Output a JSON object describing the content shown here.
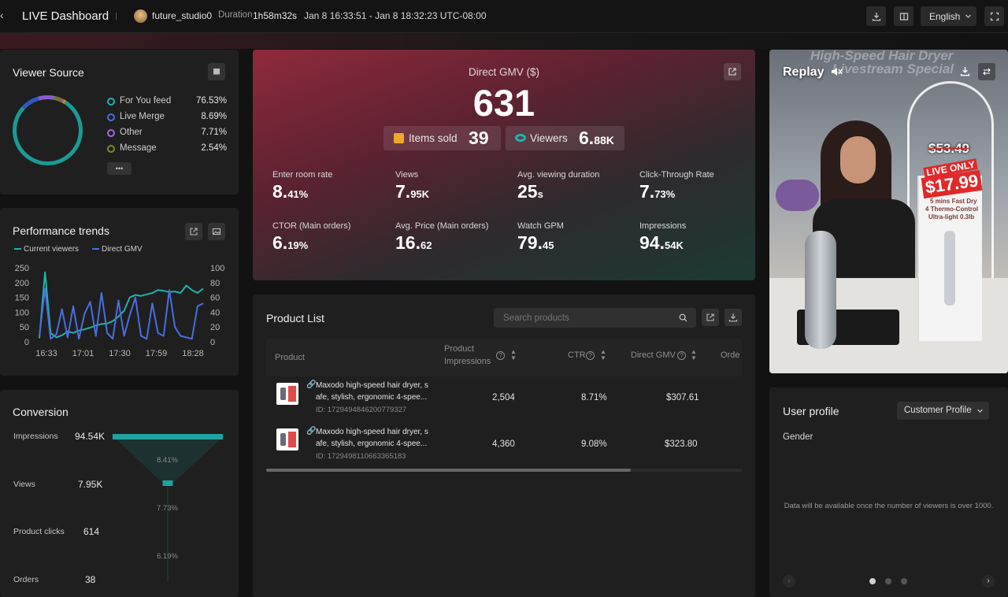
{
  "topbar": {
    "title": "LIVE Dashboard",
    "creator": "future_studio0",
    "duration_label": "Duration",
    "duration_value": "1h58m32s",
    "time_range": "Jan 8 16:33:51 - Jan 8 18:32:23 UTC-08:00",
    "language": "English"
  },
  "viewer_source": {
    "title": "Viewer Source",
    "items": [
      {
        "label": "For You feed",
        "value": "76.53%",
        "color": "#20b2aa"
      },
      {
        "label": "Live Merge",
        "value": "8.69%",
        "color": "#4a6ee0"
      },
      {
        "label": "Other",
        "value": "7.71%",
        "color": "#a06be0"
      },
      {
        "label": "Message",
        "value": "2.54%",
        "color": "#7a8a2a"
      }
    ],
    "more": "•••"
  },
  "performance": {
    "title": "Performance trends",
    "legend": [
      {
        "label": "Current viewers",
        "color": "#20b2aa"
      },
      {
        "label": "Direct GMV",
        "color": "#4a6ee0"
      }
    ]
  },
  "chart_data": {
    "type": "line",
    "x": [
      "16:33",
      "17:01",
      "17:30",
      "17:59",
      "18:28"
    ],
    "left_ticks": [
      "250",
      "200",
      "150",
      "100",
      "50",
      "0"
    ],
    "right_ticks": [
      "100",
      "80",
      "60",
      "40",
      "20",
      "0"
    ],
    "ylim_left": [
      0,
      250
    ],
    "ylim_right": [
      0,
      100
    ],
    "series": [
      {
        "name": "Current viewers",
        "color": "#20b2aa",
        "axis": "left",
        "values": [
          12,
          235,
          30,
          15,
          22,
          35,
          30,
          38,
          42,
          48,
          55,
          60,
          62,
          70,
          85,
          105,
          150,
          158,
          155,
          160,
          165,
          175,
          172,
          168,
          170,
          165,
          190,
          175,
          165,
          180
        ]
      },
      {
        "name": "Direct GMV",
        "color": "#4a6ee0",
        "axis": "left",
        "values": [
          20,
          180,
          10,
          25,
          110,
          15,
          120,
          10,
          95,
          135,
          20,
          165,
          30,
          10,
          140,
          20,
          90,
          150,
          20,
          10,
          130,
          30,
          20,
          175,
          50,
          20,
          15,
          10,
          120,
          130
        ]
      }
    ]
  },
  "conversion": {
    "title": "Conversion",
    "stages": [
      {
        "label": "Impressions",
        "value": "94.54K"
      },
      {
        "label": "Views",
        "value": "7.95K"
      },
      {
        "label": "Product clicks",
        "value": "614"
      },
      {
        "label": "Orders",
        "value": "38"
      }
    ],
    "rates": [
      "8.41%",
      "7.73%",
      "6.19%"
    ],
    "bar_fractions": [
      1.0,
      0.084,
      0.0065,
      0.0004
    ]
  },
  "gmv": {
    "title": "Direct GMV ($)",
    "value": "631",
    "items_sold_label": "Items sold",
    "items_sold_value": "39",
    "viewers_label": "Viewers",
    "viewers_value": "6.",
    "viewers_value_small": "88K",
    "metrics": [
      {
        "label": "Enter room rate",
        "big": "8.",
        "small": "41%"
      },
      {
        "label": "Views",
        "big": "7.",
        "small": "95K"
      },
      {
        "label": "Avg. viewing duration",
        "big": "25",
        "small": "s"
      },
      {
        "label": "Click-Through Rate",
        "big": "7.",
        "small": "73%"
      },
      {
        "label": "CTOR (Main orders)",
        "big": "6.",
        "small": "19%"
      },
      {
        "label": "Avg. Price (Main orders)",
        "big": "16.",
        "small": "62"
      },
      {
        "label": "Watch GPM",
        "big": "79.",
        "small": "45"
      },
      {
        "label": "Impressions",
        "big": "94.",
        "small": "54K"
      }
    ]
  },
  "product_list": {
    "title": "Product List",
    "search_placeholder": "Search products",
    "columns": {
      "product": "Product",
      "impressions_line1": "Product",
      "impressions_line2": "Impressions",
      "ctr": "CTR",
      "gmv": "Direct GMV",
      "orders": "Orde"
    },
    "rows": [
      {
        "name_line1": "Maxodo high-speed hair dryer, s",
        "name_line2": "afe, stylish, ergonomic 4-spee...",
        "id": "ID: 1729494846200779327",
        "impressions": "2,504",
        "ctr": "8.71%",
        "gmv": "$307.61"
      },
      {
        "name_line1": "Maxodo high-speed hair dryer, s",
        "name_line2": "afe, stylish, ergonomic 4-spee...",
        "id": "ID: 1729498110663365183",
        "impressions": "4,360",
        "ctr": "9.08%",
        "gmv": "$323.80"
      }
    ]
  },
  "replay": {
    "title": "Replay",
    "video_text_line1": "High-Speed Hair Dryer",
    "video_text_line2": "Livestream Special",
    "old_price": "$53.49",
    "live_only": "LIVE ONLY",
    "new_price": "$17.99",
    "box_line1": "5 mins Fast Dry",
    "box_line2": "4 Thermo-Control",
    "box_line3": "Ultra-light 0.3lb"
  },
  "user_profile": {
    "title": "User profile",
    "dropdown": "Customer Profile",
    "gender_label": "Gender",
    "notice": "Data will be available once the number of viewers is over 1000."
  }
}
